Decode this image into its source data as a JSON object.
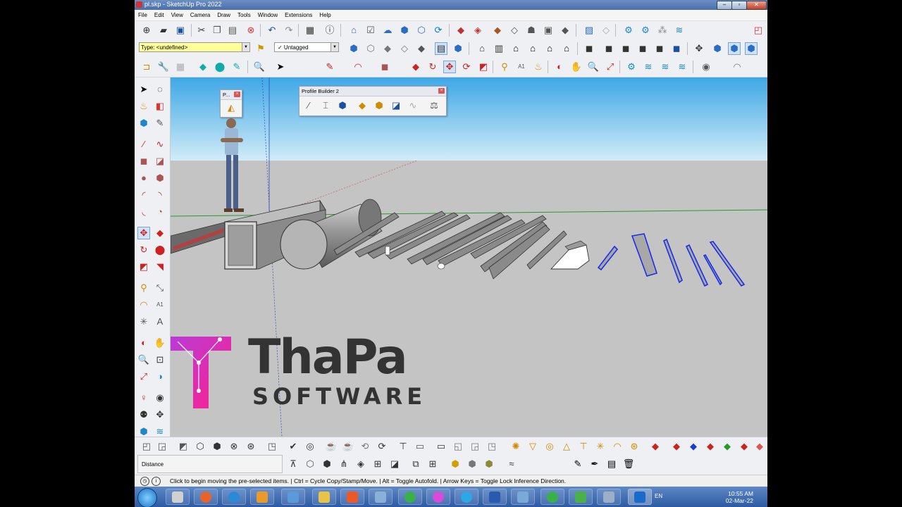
{
  "window": {
    "title": "pl.skp - SketchUp Pro 2022",
    "buttons": [
      "–",
      "▫",
      "✕"
    ]
  },
  "menu": [
    "File",
    "Edit",
    "View",
    "Camera",
    "Draw",
    "Tools",
    "Window",
    "Extensions",
    "Help"
  ],
  "type_selector": {
    "value": "Type: <undefined>"
  },
  "tag_selector": {
    "value": "✓  Untagged"
  },
  "profile_builder": {
    "title": "Profile Builder 2"
  },
  "small_panel": {
    "title": "P..."
  },
  "logo": {
    "brand": "ThaPa",
    "sub": "SOFTWARE"
  },
  "measurements": {
    "label": "Distance"
  },
  "status": {
    "message": "Click to begin moving the pre-selected items.  |  Ctrl = Cycle Copy/Stamp/Move.  |  Alt = Toggle Autofold.  |  Arrow Keys = Toggle Lock Inference Direction."
  },
  "taskbar": {
    "lang": "EN",
    "time": "10:55 AM",
    "date": "02-Mar-22"
  },
  "icons": {
    "row1": [
      "plus-circle-icon",
      "folder-open-icon",
      "save-icon",
      "cut-icon",
      "copy-icon",
      "paste-icon",
      "delete-icon",
      "undo-icon",
      "redo-icon",
      "print-icon",
      "model-info-icon",
      "layout-icon",
      "check-icon",
      "cloud-upload-icon",
      "warehouse-icon",
      "extension-warehouse-icon",
      "refresh-icon",
      "component-icon",
      "material-icon",
      "style-icon",
      "scene-icon",
      "shadow-icon",
      "fog-icon",
      "section-icon",
      "photo-texture-icon",
      "xray-icon",
      "settings-gear-icon",
      "gear-alt-icon",
      "components-icon",
      "layers-icon",
      "sketchup-logo-icon"
    ],
    "colors": {
      "accent": "#3a7bd5",
      "sky_top": "#3ea7e6",
      "sky_bottom": "#d2ecf8",
      "ground": "#c4c4c4",
      "logo_pink": "#e6219b",
      "logo_purple": "#8a3ad6"
    }
  }
}
